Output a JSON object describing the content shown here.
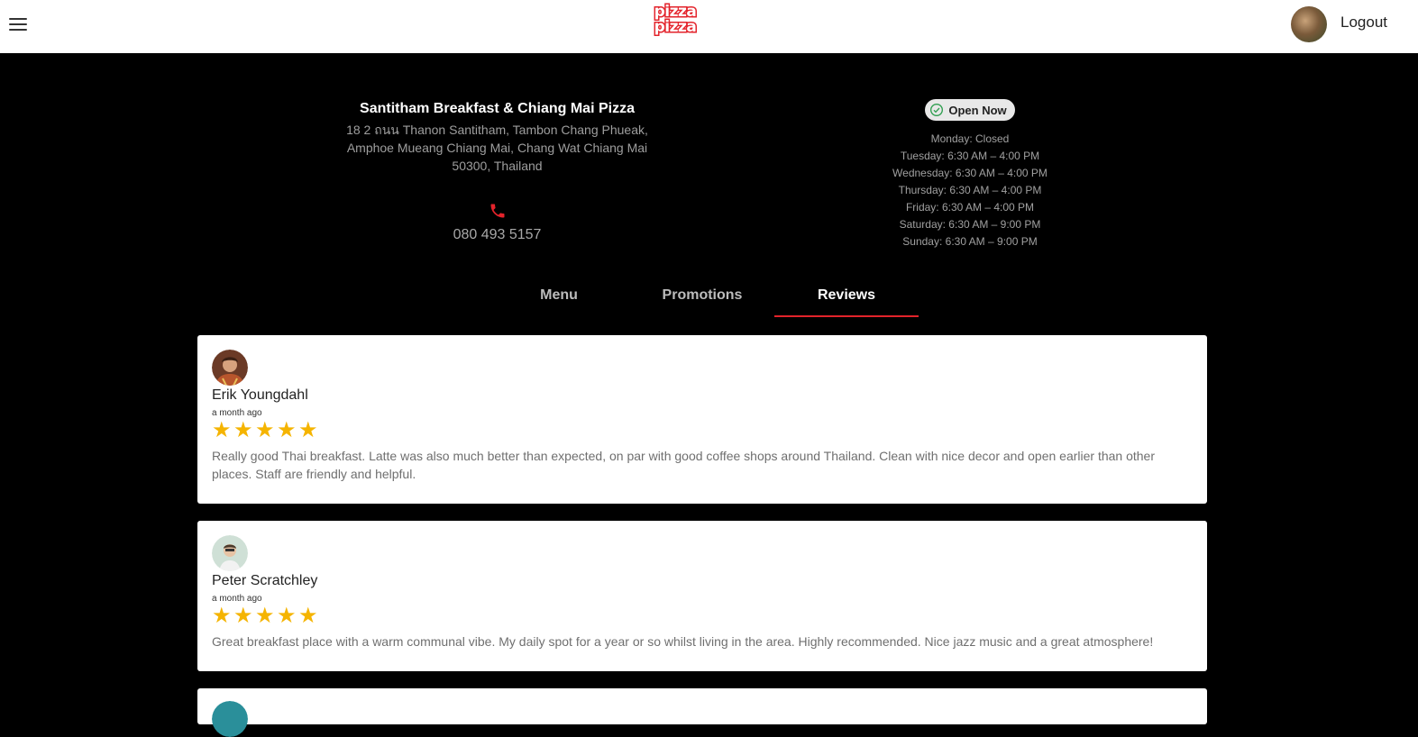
{
  "header": {
    "logo_lines": [
      "pizza",
      "pizza"
    ],
    "logout_label": "Logout"
  },
  "restaurant": {
    "name": "Santitham Breakfast & Chiang Mai Pizza",
    "address": "18 2 ถนน Thanon Santitham, Tambon Chang Phueak, Amphoe Mueang Chiang Mai, Chang Wat Chiang Mai 50300, Thailand",
    "phone": "080 493 5157",
    "status": "Open Now",
    "hours": [
      "Monday: Closed",
      "Tuesday: 6:30 AM – 4:00 PM",
      "Wednesday: 6:30 AM – 4:00 PM",
      "Thursday: 6:30 AM – 4:00 PM",
      "Friday: 6:30 AM – 4:00 PM",
      "Saturday: 6:30 AM – 9:00 PM",
      "Sunday: 6:30 AM – 9:00 PM"
    ]
  },
  "tabs": [
    {
      "label": "Menu",
      "active": false
    },
    {
      "label": "Promotions",
      "active": false
    },
    {
      "label": "Reviews",
      "active": true
    }
  ],
  "reviews": [
    {
      "author": "Erik Youngdahl",
      "time": "a month ago",
      "rating": 5,
      "text": "Really good Thai breakfast. Latte was also much better than expected, on par with good coffee shops around Thailand. Clean with nice decor and open earlier than other places. Staff are friendly and helpful."
    },
    {
      "author": "Peter Scratchley",
      "time": "a month ago",
      "rating": 5,
      "text": "Great breakfast place with a warm communal vibe. My daily spot for a year or so whilst living in the area. Highly recommended. Nice jazz music and a great atmosphere!"
    }
  ],
  "colors": {
    "brand_red": "#e3232b",
    "star": "#f5b400",
    "open_green": "#2e9e4f"
  }
}
